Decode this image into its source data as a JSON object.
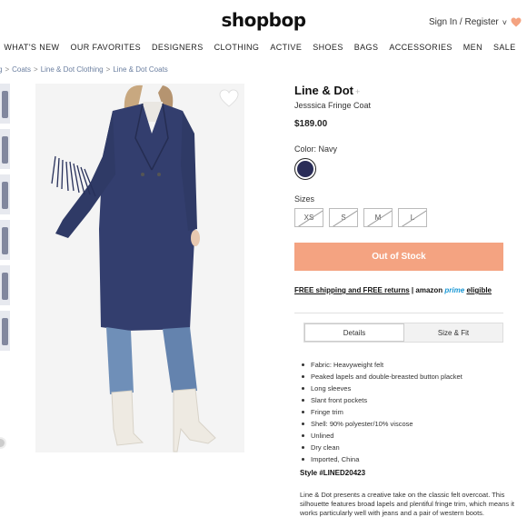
{
  "header": {
    "logo": "shopbop",
    "account_link": "Sign In / Register",
    "chevron": "˅"
  },
  "nav": {
    "items": [
      "WHAT'S NEW",
      "OUR FAVORITES",
      "DESIGNERS",
      "CLOTHING",
      "ACTIVE",
      "SHOES",
      "BAGS",
      "ACCESSORIES",
      "MEN",
      "SALE"
    ]
  },
  "breadcrumb": [
    "g",
    "Coats",
    "Line & Dot Clothing",
    "Line & Dot Coats"
  ],
  "product": {
    "brand": "Line & Dot",
    "brand_plus": "+",
    "name": "Jesssica Fringe Coat",
    "price": "$189.00",
    "color_label": "Color: Navy",
    "swatch_color": "#2a2d58",
    "sizes_label": "Sizes",
    "sizes": [
      "XS",
      "S",
      "M",
      "L"
    ],
    "cta": "Out of Stock",
    "cta_color": "#f4a381",
    "shipping": {
      "part1": "FREE shipping and FREE returns",
      "sep": " | ",
      "amazon": "amazon",
      "prime": "prime",
      "eligible": "eligible"
    }
  },
  "tabs": [
    "Details",
    "Size & Fit"
  ],
  "details": {
    "bullets": [
      "Fabric: Heavyweight felt",
      "Peaked lapels and double-breasted button placket",
      "Long sleeves",
      "Slant front pockets",
      "Fringe trim",
      "Shell: 90% polyester/10% viscose",
      "Unlined",
      "Dry clean",
      "Imported, China"
    ],
    "style": "Style #LINED20423",
    "description": "Line & Dot presents a creative take on the classic felt overcoat. This silhouette features broad lapels and plentiful fringe trim, which means it works particularly well with jeans and a pair of western boots."
  }
}
